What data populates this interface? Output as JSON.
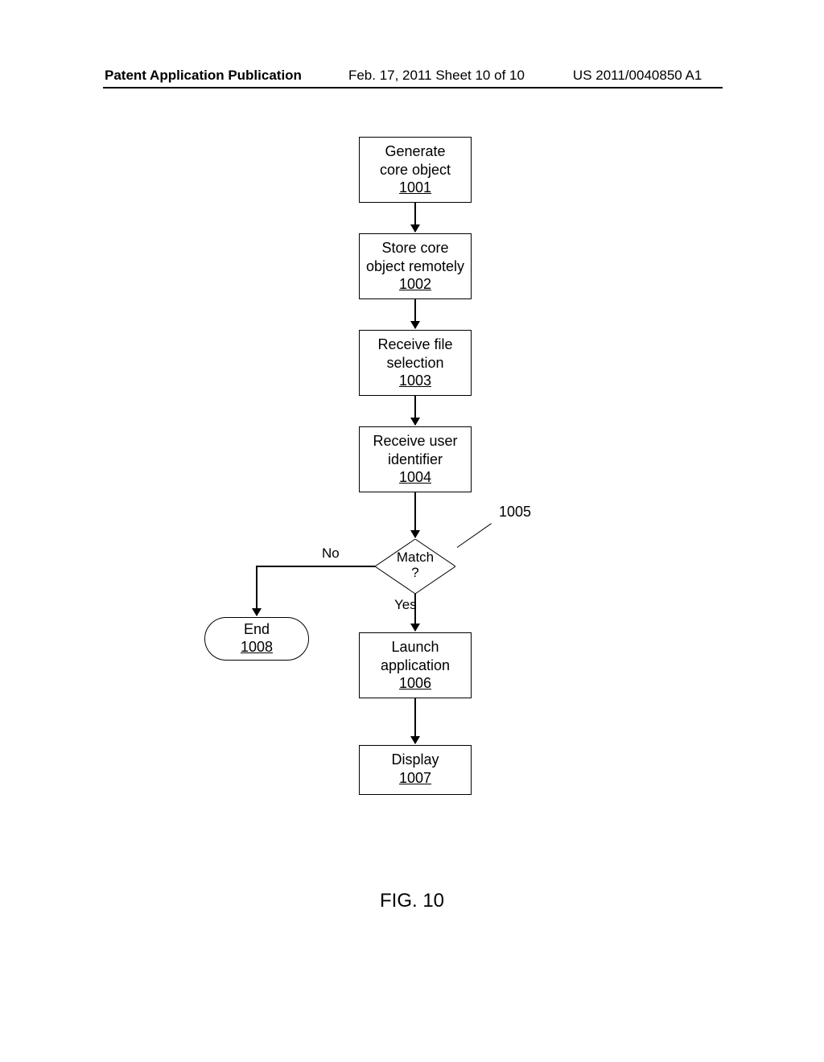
{
  "header": {
    "left": "Patent Application Publication",
    "mid": "Feb. 17, 2011  Sheet 10 of 10",
    "right": "US 2011/0040850 A1"
  },
  "figure_caption": "FIG. 10",
  "decision_ref": "1005",
  "labels": {
    "no": "No",
    "yes": "Yes"
  },
  "nodes": {
    "n1001": {
      "line1": "Generate",
      "line2": "core object",
      "num": "1001"
    },
    "n1002": {
      "line1": "Store core",
      "line2": "object remotely",
      "num": "1002"
    },
    "n1003": {
      "line1": "Receive file",
      "line2": "selection",
      "num": "1003"
    },
    "n1004": {
      "line1": "Receive user",
      "line2": "identifier",
      "num": "1004"
    },
    "n1005": {
      "line1": "Match",
      "line2": "?"
    },
    "n1006": {
      "line1": "Launch",
      "line2": "application",
      "num": "1006"
    },
    "n1007": {
      "line1": "Display",
      "num": "1007"
    },
    "n1008": {
      "line1": "End",
      "num": "1008"
    }
  }
}
